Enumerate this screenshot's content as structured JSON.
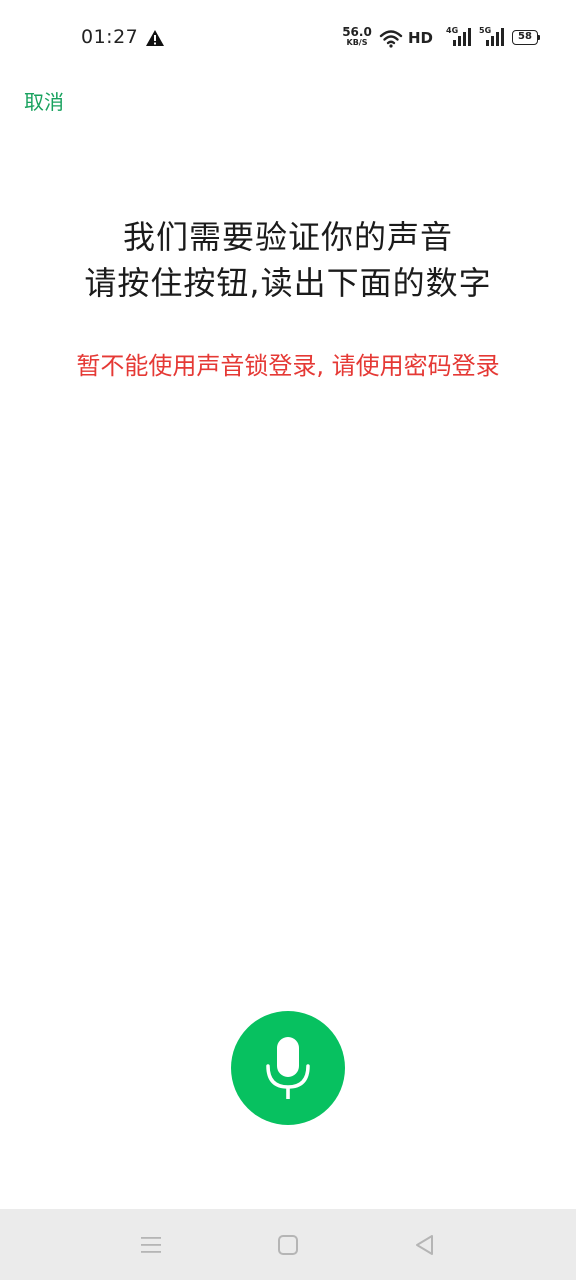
{
  "status_bar": {
    "time": "01:27",
    "net_speed_value": "56.0",
    "net_speed_unit": "KB/S",
    "hd_label": "HD",
    "signal_1_label": "4G",
    "signal_2_label": "5G",
    "battery_level": "58"
  },
  "header": {
    "cancel_label": "取消"
  },
  "main": {
    "title_line_1": "我们需要验证你的声音",
    "title_line_2": "请按住按钮,读出下面的数字",
    "warning": "暂不能使用声音锁登录, 请使用密码登录"
  },
  "colors": {
    "accent_green": "#07c160",
    "cancel_green": "#19a25f",
    "warning_red": "#e53935",
    "nav_bg": "#ebebeb"
  },
  "icons": {
    "mic": "microphone-icon",
    "nav_menu": "menu-icon",
    "nav_home": "square-home-icon",
    "nav_back": "triangle-back-icon"
  }
}
